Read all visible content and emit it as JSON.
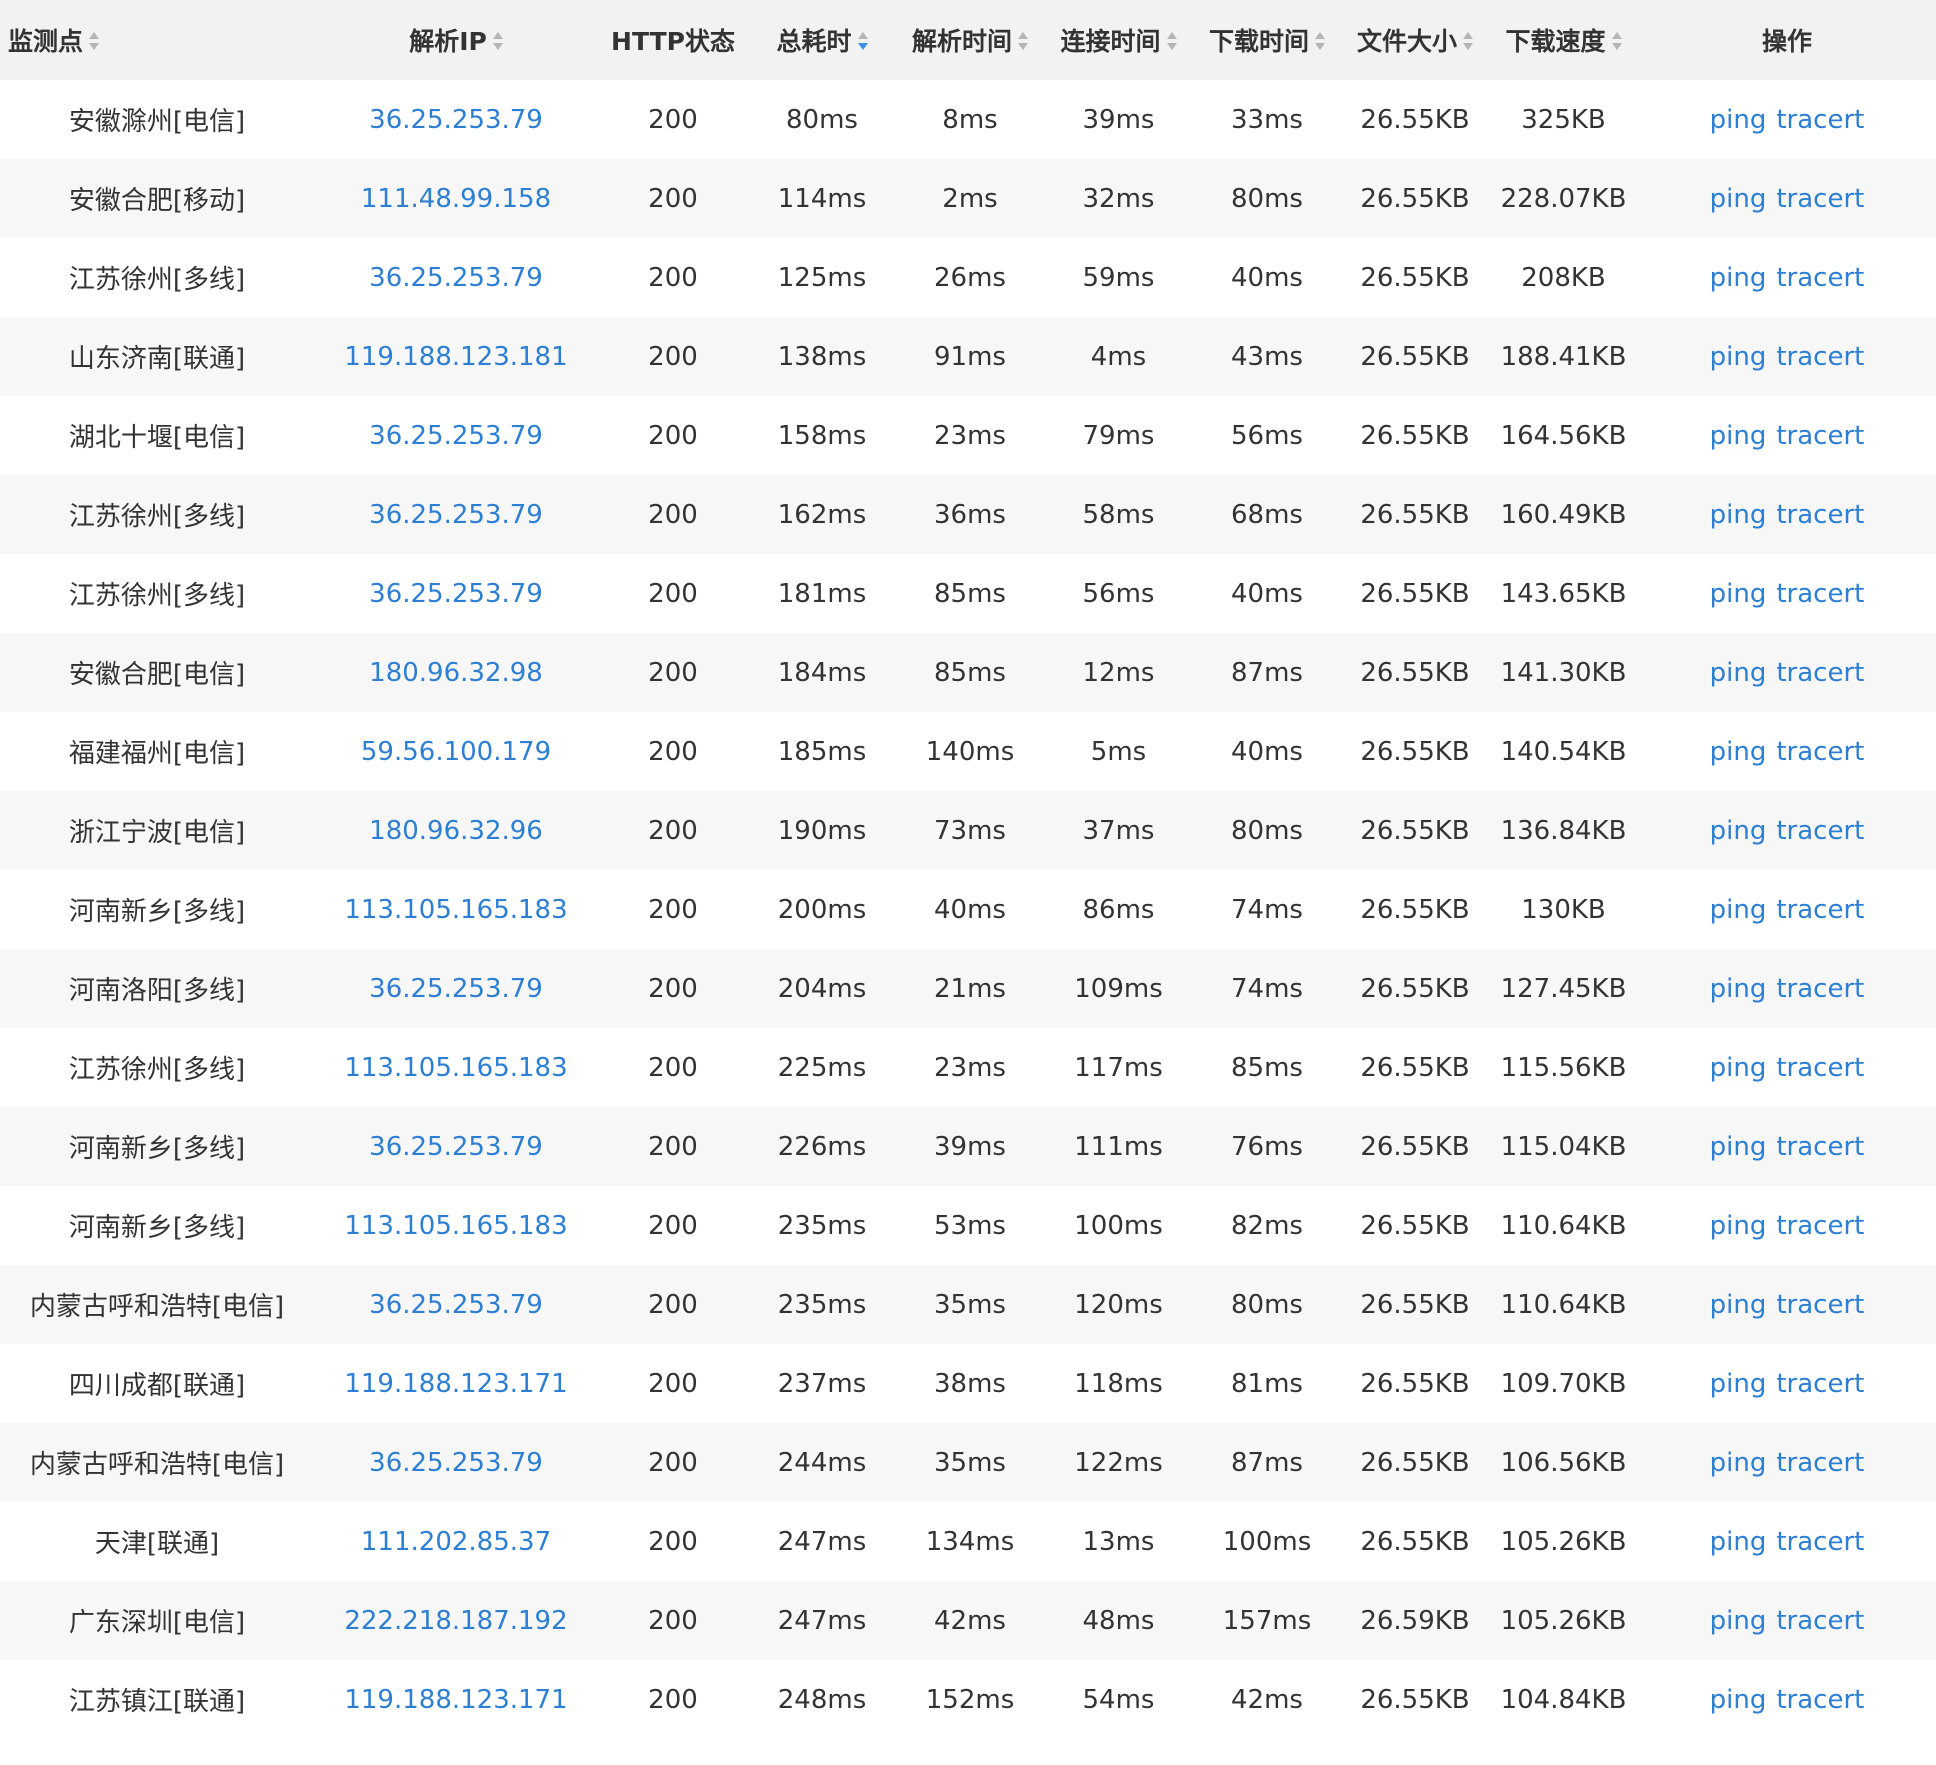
{
  "table": {
    "headers": {
      "location": "监测点",
      "ip": "解析IP",
      "status": "HTTP状态",
      "total": "总耗时",
      "dns": "解析时间",
      "connect": "连接时间",
      "download": "下载时间",
      "size": "文件大小",
      "speed": "下载速度",
      "actions": "操作"
    },
    "sort_icons": {
      "location": "sort-icon",
      "ip": "sort-icon",
      "total": "sort-desc-active-icon",
      "dns": "sort-icon",
      "connect": "sort-icon",
      "download": "sort-icon",
      "size": "sort-icon",
      "speed": "sort-icon"
    },
    "accent_color": "#2d7fd3",
    "action_labels": {
      "ping": "ping",
      "tracert": "tracert"
    },
    "rows": [
      {
        "location": "安徽滁州[电信]",
        "ip": "36.25.253.79",
        "status": "200",
        "total": "80ms",
        "dns": "8ms",
        "connect": "39ms",
        "download": "33ms",
        "size": "26.55KB",
        "speed": "325KB"
      },
      {
        "location": "安徽合肥[移动]",
        "ip": "111.48.99.158",
        "status": "200",
        "total": "114ms",
        "dns": "2ms",
        "connect": "32ms",
        "download": "80ms",
        "size": "26.55KB",
        "speed": "228.07KB"
      },
      {
        "location": "江苏徐州[多线]",
        "ip": "36.25.253.79",
        "status": "200",
        "total": "125ms",
        "dns": "26ms",
        "connect": "59ms",
        "download": "40ms",
        "size": "26.55KB",
        "speed": "208KB"
      },
      {
        "location": "山东济南[联通]",
        "ip": "119.188.123.181",
        "status": "200",
        "total": "138ms",
        "dns": "91ms",
        "connect": "4ms",
        "download": "43ms",
        "size": "26.55KB",
        "speed": "188.41KB"
      },
      {
        "location": "湖北十堰[电信]",
        "ip": "36.25.253.79",
        "status": "200",
        "total": "158ms",
        "dns": "23ms",
        "connect": "79ms",
        "download": "56ms",
        "size": "26.55KB",
        "speed": "164.56KB"
      },
      {
        "location": "江苏徐州[多线]",
        "ip": "36.25.253.79",
        "status": "200",
        "total": "162ms",
        "dns": "36ms",
        "connect": "58ms",
        "download": "68ms",
        "size": "26.55KB",
        "speed": "160.49KB"
      },
      {
        "location": "江苏徐州[多线]",
        "ip": "36.25.253.79",
        "status": "200",
        "total": "181ms",
        "dns": "85ms",
        "connect": "56ms",
        "download": "40ms",
        "size": "26.55KB",
        "speed": "143.65KB"
      },
      {
        "location": "安徽合肥[电信]",
        "ip": "180.96.32.98",
        "status": "200",
        "total": "184ms",
        "dns": "85ms",
        "connect": "12ms",
        "download": "87ms",
        "size": "26.55KB",
        "speed": "141.30KB"
      },
      {
        "location": "福建福州[电信]",
        "ip": "59.56.100.179",
        "status": "200",
        "total": "185ms",
        "dns": "140ms",
        "connect": "5ms",
        "download": "40ms",
        "size": "26.55KB",
        "speed": "140.54KB"
      },
      {
        "location": "浙江宁波[电信]",
        "ip": "180.96.32.96",
        "status": "200",
        "total": "190ms",
        "dns": "73ms",
        "connect": "37ms",
        "download": "80ms",
        "size": "26.55KB",
        "speed": "136.84KB"
      },
      {
        "location": "河南新乡[多线]",
        "ip": "113.105.165.183",
        "status": "200",
        "total": "200ms",
        "dns": "40ms",
        "connect": "86ms",
        "download": "74ms",
        "size": "26.55KB",
        "speed": "130KB"
      },
      {
        "location": "河南洛阳[多线]",
        "ip": "36.25.253.79",
        "status": "200",
        "total": "204ms",
        "dns": "21ms",
        "connect": "109ms",
        "download": "74ms",
        "size": "26.55KB",
        "speed": "127.45KB"
      },
      {
        "location": "江苏徐州[多线]",
        "ip": "113.105.165.183",
        "status": "200",
        "total": "225ms",
        "dns": "23ms",
        "connect": "117ms",
        "download": "85ms",
        "size": "26.55KB",
        "speed": "115.56KB"
      },
      {
        "location": "河南新乡[多线]",
        "ip": "36.25.253.79",
        "status": "200",
        "total": "226ms",
        "dns": "39ms",
        "connect": "111ms",
        "download": "76ms",
        "size": "26.55KB",
        "speed": "115.04KB"
      },
      {
        "location": "河南新乡[多线]",
        "ip": "113.105.165.183",
        "status": "200",
        "total": "235ms",
        "dns": "53ms",
        "connect": "100ms",
        "download": "82ms",
        "size": "26.55KB",
        "speed": "110.64KB"
      },
      {
        "location": "内蒙古呼和浩特[电信]",
        "ip": "36.25.253.79",
        "status": "200",
        "total": "235ms",
        "dns": "35ms",
        "connect": "120ms",
        "download": "80ms",
        "size": "26.55KB",
        "speed": "110.64KB"
      },
      {
        "location": "四川成都[联通]",
        "ip": "119.188.123.171",
        "status": "200",
        "total": "237ms",
        "dns": "38ms",
        "connect": "118ms",
        "download": "81ms",
        "size": "26.55KB",
        "speed": "109.70KB"
      },
      {
        "location": "内蒙古呼和浩特[电信]",
        "ip": "36.25.253.79",
        "status": "200",
        "total": "244ms",
        "dns": "35ms",
        "connect": "122ms",
        "download": "87ms",
        "size": "26.55KB",
        "speed": "106.56KB"
      },
      {
        "location": "天津[联通]",
        "ip": "111.202.85.37",
        "status": "200",
        "total": "247ms",
        "dns": "134ms",
        "connect": "13ms",
        "download": "100ms",
        "size": "26.55KB",
        "speed": "105.26KB"
      },
      {
        "location": "广东深圳[电信]",
        "ip": "222.218.187.192",
        "status": "200",
        "total": "247ms",
        "dns": "42ms",
        "connect": "48ms",
        "download": "157ms",
        "size": "26.59KB",
        "speed": "105.26KB"
      },
      {
        "location": "江苏镇江[联通]",
        "ip": "119.188.123.171",
        "status": "200",
        "total": "248ms",
        "dns": "152ms",
        "connect": "54ms",
        "download": "42ms",
        "size": "26.55KB",
        "speed": "104.84KB"
      }
    ]
  }
}
